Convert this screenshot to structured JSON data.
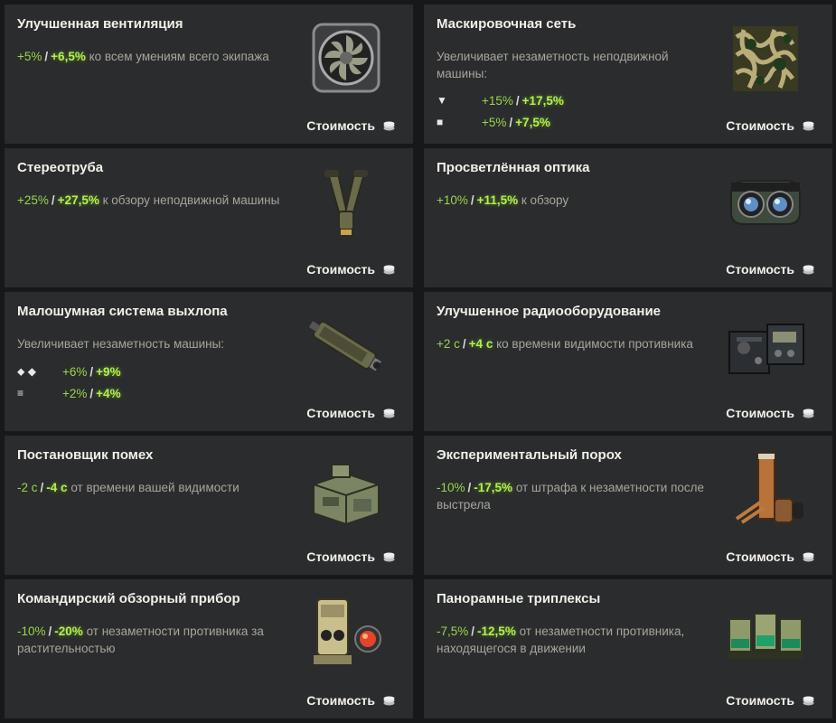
{
  "cost_label": "Стоимость",
  "cards": [
    {
      "id": "ventilation",
      "icon": "ventilation-fan-icon",
      "title": "Улучшенная вентиляция",
      "bonus": {
        "v1": "+5%",
        "sep": "/",
        "v2": "+6,5%",
        "text": "ко всем умениям всего экипажа"
      }
    },
    {
      "id": "camo-net",
      "icon": "camouflage-net-icon",
      "title": "Маскировочная сеть",
      "description": "Увеличивает незаметность неподвижной машины:",
      "tiers": [
        {
          "glyph": "▼",
          "v1": "+15%",
          "sep": "/",
          "v2": "+17,5%"
        },
        {
          "glyph": "■",
          "v1": "+5%",
          "sep": "/",
          "v2": "+7,5%"
        }
      ]
    },
    {
      "id": "binoculars",
      "icon": "stereo-binoculars-icon",
      "title": "Стереотруба",
      "bonus": {
        "v1": "+25%",
        "sep": "/",
        "v2": "+27,5%",
        "text": "к обзору неподвижной машины"
      }
    },
    {
      "id": "optics",
      "icon": "coated-optics-icon",
      "title": "Просветлённая оптика",
      "bonus": {
        "v1": "+10%",
        "sep": "/",
        "v2": "+11,5%",
        "text": "к обзору"
      }
    },
    {
      "id": "exhaust",
      "icon": "exhaust-system-icon",
      "title": "Малошумная система выхлопа",
      "description": "Увеличивает незаметность машины:",
      "tiers": [
        {
          "glyph": "⬥ ◆",
          "v1": "+6%",
          "sep": "/",
          "v2": "+9%"
        },
        {
          "glyph": "≡",
          "v1": "+2%",
          "sep": "/",
          "v2": "+4%"
        }
      ]
    },
    {
      "id": "radio",
      "icon": "radio-equipment-icon",
      "title": "Улучшенное радиооборудование",
      "bonus": {
        "v1": "+2 с",
        "sep": "/",
        "v2": "+4 с",
        "text": "ко времени видимости противника"
      }
    },
    {
      "id": "jammer",
      "icon": "jammer-icon",
      "title": "Постановщик помех",
      "bonus": {
        "v1": "-2 с",
        "sep": "/",
        "v2": "-4 с",
        "text": "от времени вашей видимости"
      }
    },
    {
      "id": "powder",
      "icon": "experimental-powder-icon",
      "title": "Экспериментальный порох",
      "bonus": {
        "v1": "-10%",
        "sep": "/",
        "v2": "-17,5%",
        "text": "от штрафа к незаметности после выстрела"
      }
    },
    {
      "id": "commander-vision",
      "icon": "commander-vision-icon",
      "title": "Командирский обзорный прибор",
      "bonus": {
        "v1": "-10%",
        "sep": "/",
        "v2": "-20%",
        "text": "от незаметности противника за растительностью"
      }
    },
    {
      "id": "triplexes",
      "icon": "panoramic-triplex-icon",
      "title": "Панорамные триплексы",
      "bonus": {
        "v1": "-7,5%",
        "sep": "/",
        "v2": "-12,5%",
        "text": "от незаметности противника, находящегося в движении"
      }
    }
  ],
  "colors": {
    "card_bg": "#2b2c2e",
    "page_bg": "#17181a",
    "bonus_base": "#9ad64a",
    "bonus_improved": "#b4f04c",
    "text_muted": "#a8a59c"
  }
}
